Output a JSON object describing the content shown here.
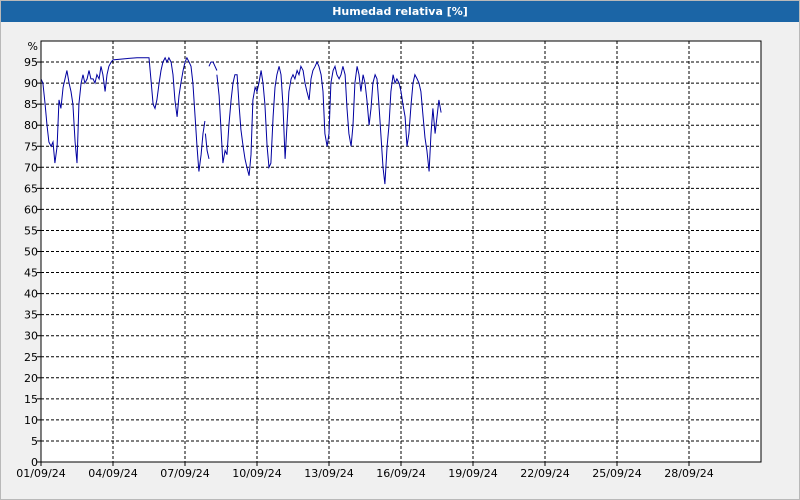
{
  "window": {
    "title": "Humedad relativa [%]"
  },
  "colors": {
    "titlebar": "#1b65a6",
    "series": "#0000a0",
    "grid": "#000000",
    "plot_bg": "#ffffff"
  },
  "chart_data": {
    "type": "line",
    "title": "Humedad relativa [%]",
    "xlabel": "",
    "ylabel": "%",
    "x_unit": "day of September 2024",
    "xlim": [
      1,
      31
    ],
    "ylim": [
      0,
      100
    ],
    "grid": true,
    "legend": "none",
    "y_ticks": [
      0,
      5,
      10,
      15,
      20,
      25,
      30,
      35,
      40,
      45,
      50,
      55,
      60,
      65,
      70,
      75,
      80,
      85,
      90,
      95
    ],
    "x_ticks": [
      {
        "day": 1,
        "label": "01/09/24"
      },
      {
        "day": 4,
        "label": "04/09/24"
      },
      {
        "day": 7,
        "label": "07/09/24"
      },
      {
        "day": 10,
        "label": "10/09/24"
      },
      {
        "day": 13,
        "label": "13/09/24"
      },
      {
        "day": 16,
        "label": "16/09/24"
      },
      {
        "day": 19,
        "label": "19/09/24"
      },
      {
        "day": 22,
        "label": "22/09/24"
      },
      {
        "day": 25,
        "label": "25/09/24"
      },
      {
        "day": 28,
        "label": "28/09/24"
      }
    ],
    "series": [
      {
        "segments": [
          [
            [
              1.0,
              91
            ],
            [
              1.08,
              90
            ],
            [
              1.17,
              85
            ],
            [
              1.25,
              80
            ],
            [
              1.33,
              76
            ],
            [
              1.42,
              75
            ],
            [
              1.5,
              76
            ],
            [
              1.58,
              71
            ],
            [
              1.67,
              75
            ],
            [
              1.75,
              86
            ],
            [
              1.83,
              84
            ],
            [
              1.92,
              89
            ],
            [
              2.0,
              91
            ],
            [
              2.08,
              93
            ],
            [
              2.17,
              90
            ],
            [
              2.25,
              88
            ],
            [
              2.33,
              85
            ],
            [
              2.42,
              76
            ],
            [
              2.5,
              71
            ],
            [
              2.58,
              85
            ],
            [
              2.67,
              90
            ],
            [
              2.75,
              92
            ],
            [
              2.83,
              90
            ],
            [
              2.92,
              91
            ],
            [
              3.0,
              93
            ],
            [
              3.08,
              91
            ],
            [
              3.17,
              91
            ],
            [
              3.25,
              90
            ],
            [
              3.33,
              92
            ],
            [
              3.42,
              91
            ],
            [
              3.5,
              94
            ],
            [
              3.58,
              92
            ],
            [
              3.67,
              88
            ],
            [
              3.75,
              92
            ],
            [
              3.83,
              94
            ],
            [
              3.92,
              95
            ],
            [
              4.0,
              95.5
            ],
            [
              4.5,
              95.8
            ],
            [
              5.0,
              96
            ],
            [
              5.42,
              96
            ],
            [
              5.5,
              96
            ],
            [
              5.58,
              91
            ],
            [
              5.67,
              85
            ],
            [
              5.75,
              84
            ],
            [
              5.83,
              86
            ],
            [
              5.92,
              90
            ],
            [
              6.0,
              93
            ],
            [
              6.08,
              95
            ],
            [
              6.17,
              96
            ],
            [
              6.25,
              95
            ],
            [
              6.33,
              96
            ],
            [
              6.42,
              95
            ],
            [
              6.5,
              92
            ],
            [
              6.58,
              86
            ],
            [
              6.67,
              82
            ],
            [
              6.75,
              87
            ],
            [
              6.83,
              90
            ],
            [
              6.92,
              93
            ],
            [
              7.0,
              95
            ],
            [
              7.08,
              96
            ],
            [
              7.17,
              95
            ],
            [
              7.25,
              94
            ],
            [
              7.33,
              90
            ],
            [
              7.42,
              82
            ],
            [
              7.5,
              75
            ],
            [
              7.58,
              69
            ],
            [
              7.67,
              73
            ],
            [
              7.75,
              78
            ],
            [
              7.83,
              81
            ]
          ],
          [
            [
              7.85,
              78
            ],
            [
              7.92,
              74
            ],
            [
              8.0,
              72
            ]
          ],
          [
            [
              8.0,
              94
            ],
            [
              8.08,
              95
            ],
            [
              8.17,
              95
            ],
            [
              8.25,
              94
            ],
            [
              8.33,
              93
            ]
          ],
          [
            [
              8.33,
              92
            ],
            [
              8.42,
              87
            ],
            [
              8.5,
              79
            ],
            [
              8.58,
              71
            ],
            [
              8.67,
              74
            ],
            [
              8.75,
              73
            ],
            [
              8.83,
              80
            ],
            [
              8.92,
              86
            ],
            [
              9.0,
              90
            ],
            [
              9.08,
              92
            ],
            [
              9.17,
              92
            ],
            [
              9.25,
              85
            ],
            [
              9.33,
              79
            ],
            [
              9.42,
              75
            ],
            [
              9.5,
              72
            ],
            [
              9.58,
              70
            ],
            [
              9.67,
              68
            ],
            [
              9.75,
              73
            ],
            [
              9.83,
              86
            ],
            [
              9.92,
              89
            ],
            [
              10.0,
              88
            ],
            [
              10.08,
              90
            ],
            [
              10.17,
              93
            ],
            [
              10.25,
              90
            ],
            [
              10.33,
              85
            ],
            [
              10.42,
              75
            ],
            [
              10.5,
              70
            ],
            [
              10.58,
              71
            ],
            [
              10.67,
              82
            ],
            [
              10.75,
              89
            ],
            [
              10.83,
              92
            ],
            [
              10.92,
              94
            ],
            [
              11.0,
              92
            ],
            [
              11.08,
              85
            ],
            [
              11.17,
              72
            ],
            [
              11.25,
              80
            ],
            [
              11.33,
              88
            ],
            [
              11.42,
              91
            ],
            [
              11.5,
              92
            ],
            [
              11.58,
              91
            ],
            [
              11.67,
              93
            ],
            [
              11.75,
              92
            ],
            [
              11.83,
              94
            ],
            [
              11.92,
              93
            ],
            [
              12.0,
              90
            ],
            [
              12.08,
              88
            ],
            [
              12.17,
              86
            ],
            [
              12.25,
              91
            ],
            [
              12.33,
              93
            ],
            [
              12.42,
              94
            ],
            [
              12.5,
              95
            ],
            [
              12.58,
              94
            ],
            [
              12.67,
              92
            ],
            [
              12.75,
              88
            ],
            [
              12.83,
              78
            ],
            [
              12.92,
              75
            ],
            [
              13.0,
              78
            ],
            [
              13.08,
              90
            ],
            [
              13.17,
              93
            ],
            [
              13.25,
              94
            ],
            [
              13.33,
              92
            ],
            [
              13.42,
              91
            ],
            [
              13.5,
              92
            ],
            [
              13.58,
              94
            ],
            [
              13.67,
              92
            ],
            [
              13.75,
              84
            ],
            [
              13.83,
              78
            ],
            [
              13.92,
              75
            ],
            [
              14.0,
              80
            ],
            [
              14.08,
              90
            ],
            [
              14.17,
              94
            ],
            [
              14.25,
              92
            ],
            [
              14.33,
              88
            ],
            [
              14.42,
              92
            ],
            [
              14.5,
              90
            ],
            [
              14.58,
              86
            ],
            [
              14.67,
              80
            ],
            [
              14.75,
              84
            ],
            [
              14.83,
              90
            ],
            [
              14.92,
              92
            ],
            [
              15.0,
              91
            ],
            [
              15.08,
              85
            ],
            [
              15.17,
              77
            ],
            [
              15.25,
              70
            ],
            [
              15.33,
              66
            ],
            [
              15.42,
              75
            ],
            [
              15.5,
              80
            ],
            [
              15.58,
              88
            ],
            [
              15.67,
              92
            ],
            [
              15.75,
              90
            ],
            [
              15.83,
              91
            ],
            [
              15.92,
              90
            ],
            [
              16.0,
              88
            ],
            [
              16.08,
              85
            ],
            [
              16.17,
              82
            ],
            [
              16.25,
              75
            ],
            [
              16.33,
              78
            ],
            [
              16.42,
              85
            ],
            [
              16.5,
              90
            ],
            [
              16.58,
              92
            ],
            [
              16.67,
              91
            ],
            [
              16.75,
              90
            ],
            [
              16.83,
              88
            ],
            [
              16.92,
              82
            ],
            [
              17.0,
              77
            ],
            [
              17.08,
              74
            ],
            [
              17.17,
              69
            ],
            [
              17.25,
              78
            ],
            [
              17.33,
              84
            ],
            [
              17.42,
              78
            ],
            [
              17.5,
              82
            ],
            [
              17.58,
              86
            ],
            [
              17.67,
              83
            ]
          ]
        ]
      }
    ]
  }
}
